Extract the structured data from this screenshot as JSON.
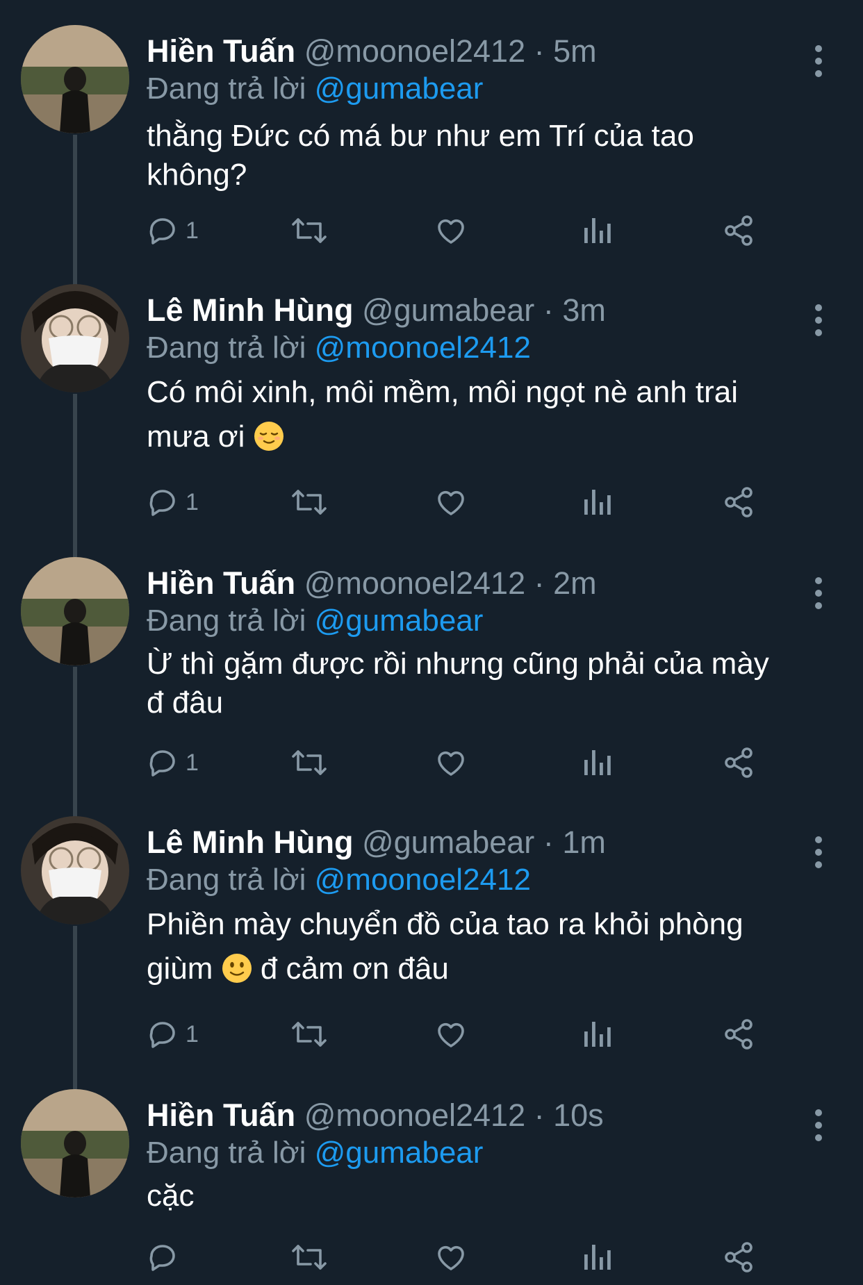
{
  "tweets": [
    {
      "name": "Hiền Tuấn",
      "handle": "@moonoel2412",
      "time": "5m",
      "reply_prefix": "Đang trả lời",
      "reply_to": "@gumabear",
      "lines": [
        "thằng Đức có má bư như em Trí của tao",
        "không?"
      ],
      "reply_count": "1",
      "avatar": "avatar-hien-tuan"
    },
    {
      "name": "Lê Minh Hùng",
      "handle": "@gumabear",
      "time": "3m",
      "reply_prefix": "Đang trả lời",
      "reply_to": "@moonoel2412",
      "lines": [
        "Có môi xinh, môi mềm, môi ngọt nè anh trai",
        "mưa ơi"
      ],
      "reply_count": "1",
      "avatar": "avatar-le-minh-hung"
    },
    {
      "name": "Hiền Tuấn",
      "handle": "@moonoel2412",
      "time": "2m",
      "reply_prefix": "Đang trả lời",
      "reply_to": "@gumabear",
      "lines": [
        "Ừ thì gặm được rồi nhưng cũng phải của mày",
        "đ đâu"
      ],
      "reply_count": "1",
      "avatar": "avatar-hien-tuan"
    },
    {
      "name": "Lê Minh Hùng",
      "handle": "@gumabear",
      "time": "1m",
      "reply_prefix": "Đang trả lời",
      "reply_to": "@moonoel2412",
      "lines": [
        "Phiền mày chuyển đồ của tao ra khỏi phòng",
        "giùm",
        "đ cảm ơn đâu"
      ],
      "reply_count": "1",
      "avatar": "avatar-le-minh-hung"
    },
    {
      "name": "Hiền Tuấn",
      "handle": "@moonoel2412",
      "time": "10s",
      "reply_prefix": "Đang trả lời",
      "reply_to": "@gumabear",
      "lines": [
        "cặc"
      ],
      "reply_count": "",
      "avatar": "avatar-hien-tuan"
    }
  ],
  "separator": "·",
  "icons": [
    "reply-icon",
    "retweet-icon",
    "like-icon",
    "analytics-icon",
    "share-icon",
    "more-icon",
    "smiling-face-emoji",
    "relieved-face-emoji"
  ],
  "colors": {
    "background": "#15202b",
    "name": "#ffffff",
    "muted": "#8899a6",
    "link": "#1d9bf0",
    "thread_line": "#38444d"
  }
}
